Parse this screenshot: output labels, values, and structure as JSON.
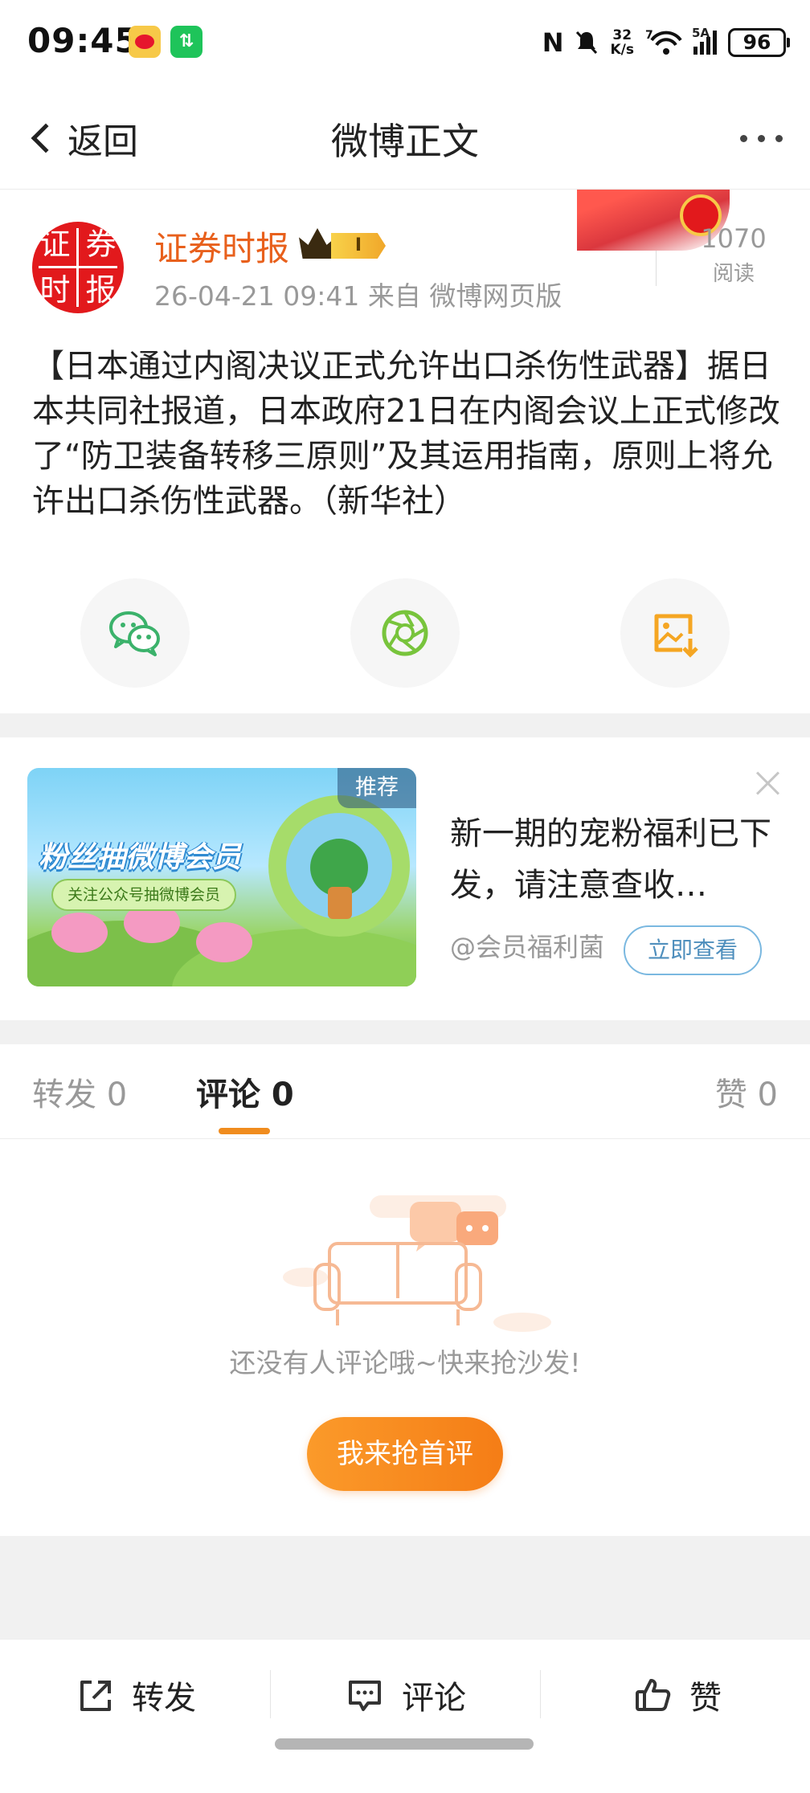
{
  "status_bar": {
    "time": "09:45",
    "net_speed_value": "32",
    "net_speed_unit": "K/s",
    "wifi_label": "7",
    "cell_label": "5A",
    "battery": "96",
    "icons": [
      "weibo-app-icon",
      "green-app-icon",
      "nfc-icon",
      "mute-icon",
      "wifi-icon",
      "signal-icon",
      "battery-icon"
    ]
  },
  "nav": {
    "back_label": "返回",
    "title": "微博正文"
  },
  "post": {
    "author": "证券时报",
    "vip_level": "I",
    "meta": "26-04-21 09:41  来自 微博网页版",
    "read_count": "1070",
    "read_label": "阅读",
    "body": "【日本通过内阁决议正式允许出口杀伤性武器】据日本共同社报道，日本政府21日在内阁会议上正式修改了“防卫装备转移三原则”及其运用指南，原则上将允许出口杀伤性武器。（新华社）",
    "avatar_chars": [
      "证",
      "券",
      "时",
      "报"
    ]
  },
  "share": {
    "icons": [
      "wechat-icon",
      "moments-icon",
      "save-image-icon"
    ]
  },
  "ad": {
    "tag": "推荐",
    "headline": "粉丝抽微博会员",
    "pill": "关注公众号抽微博会员",
    "text": "新一期的宠粉福利已下发，请注意查收…",
    "source": "@会员福利菌",
    "cta": "立即查看"
  },
  "tabs": {
    "repost": "转发 0",
    "comment": "评论 0",
    "like": "赞 0"
  },
  "empty": {
    "message": "还没有人评论哦~快来抢沙发!",
    "button": "我来抢首评"
  },
  "bottom_bar": {
    "repost": "转发",
    "comment": "评论",
    "like": "赞"
  },
  "colors": {
    "accent_orange": "#f08c1e",
    "author_orange": "#e8601c",
    "wechat_green": "#3bb26b",
    "moments_green": "#78c43c",
    "save_orange": "#f5a623"
  }
}
